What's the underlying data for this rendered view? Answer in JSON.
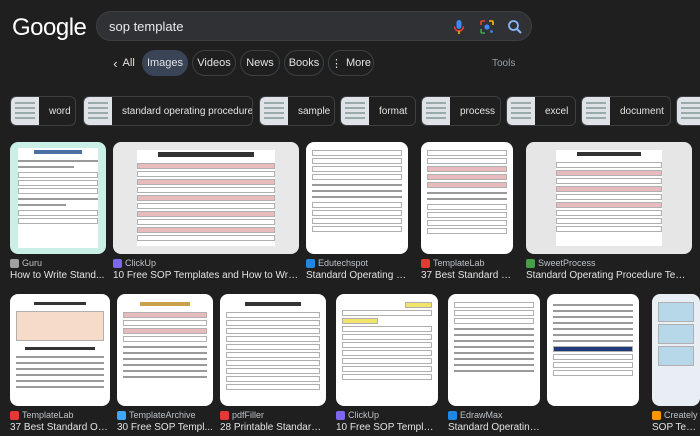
{
  "header": {
    "logo_text": "Google",
    "search_query": "sop template",
    "icons": [
      "mic-icon",
      "lens-icon",
      "search-icon"
    ],
    "colors": {
      "mic": "#4285f4",
      "lens_red": "#ea4335",
      "lens_yellow": "#fbbc04",
      "search": "#8ab4f8"
    }
  },
  "tabs": {
    "back_label": "‹",
    "all": "All",
    "items": [
      {
        "label": "Images",
        "active": true
      },
      {
        "label": "Videos"
      },
      {
        "label": "News"
      },
      {
        "label": "Books"
      },
      {
        "label": "More",
        "icon": "more-vert-icon"
      }
    ],
    "tools": "Tools"
  },
  "chips": [
    "word",
    "standard operating procedure",
    "sample",
    "format",
    "process",
    "excel",
    "document"
  ],
  "results_row1": [
    {
      "source": "Guru",
      "title": "How to Write Stand...",
      "favicon_color": "#a0a0a0"
    },
    {
      "source": "ClickUp",
      "title": "10 Free SOP Templates and How to Write ...",
      "favicon_color": "#7b68ee"
    },
    {
      "source": "Edutechspot",
      "title": "Standard Operating Pr...",
      "favicon_color": "#1e88e5"
    },
    {
      "source": "TemplateLab",
      "title": "37 Best Standard O...",
      "favicon_color": "#e53935"
    },
    {
      "source": "SweetProcess",
      "title": "Standard Operating Procedure Templat...",
      "favicon_color": "#43a047"
    }
  ],
  "results_row2": [
    {
      "source": "TemplateLab",
      "title": "37 Best Standard Op...",
      "favicon_color": "#e53935"
    },
    {
      "source": "TemplateArchive",
      "title": "30 Free SOP Templ...",
      "favicon_color": "#42a5f5"
    },
    {
      "source": "pdfFiller",
      "title": "28 Printable Standard ...",
      "favicon_color": "#e53935"
    },
    {
      "source": "ClickUp",
      "title": "10 Free SOP Templates ...",
      "favicon_color": "#7b68ee"
    },
    {
      "source": "EdrawMax",
      "title": "Standard Operating Procedure ...",
      "favicon_color": "#1e88e5"
    },
    {
      "source": "Creately",
      "title": "SOP Temp...",
      "favicon_color": "#ff9800"
    }
  ]
}
